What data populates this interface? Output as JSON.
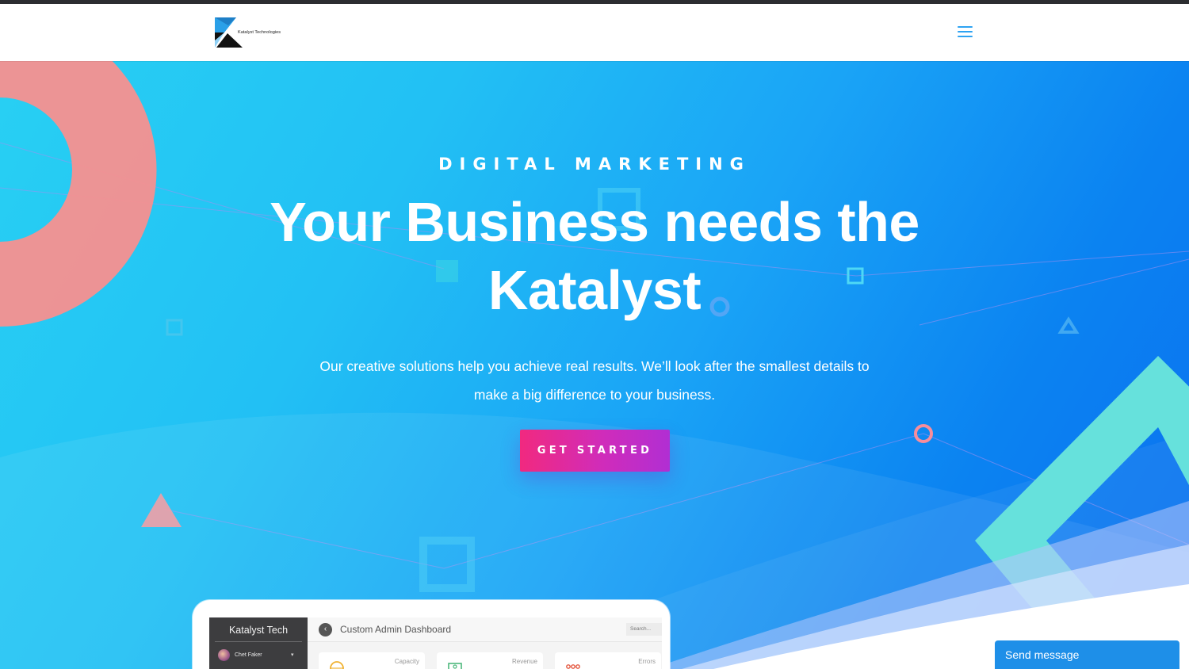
{
  "header": {
    "logo_text": "Katalyst Technologies",
    "menu_icon": "hamburger-menu-icon"
  },
  "hero": {
    "eyebrow": "DIGITAL MARKETING",
    "headline_line1": "Your Business needs the",
    "headline_line2": "Katalyst",
    "subtext_line1": "Our creative solutions help you achieve real results.  We’ll look after the smallest details to",
    "subtext_line2": "make a big difference to your business.",
    "cta_label": "GET STARTED"
  },
  "dashboard_preview": {
    "brand": "Katalyst Tech",
    "user": "Chet Faker",
    "title": "Custom Admin Dashboard",
    "search_placeholder": "Search...",
    "cards": [
      {
        "label": "Capacity",
        "icon": "globe-icon"
      },
      {
        "label": "Revenue",
        "icon": "money-icon"
      },
      {
        "label": "Errors",
        "icon": "network-icon"
      }
    ]
  },
  "chat": {
    "label": "Send message"
  },
  "colors": {
    "hero_gradient_start": "#28d0f3",
    "hero_gradient_end": "#0b6ff0",
    "cta_start": "#f1297f",
    "cta_end": "#b12ed3",
    "accent_coral": "#f7908f",
    "accent_teal": "#6be3dc",
    "menu_blue": "#2ea3f2",
    "chat_blue": "#1e8fe8"
  }
}
